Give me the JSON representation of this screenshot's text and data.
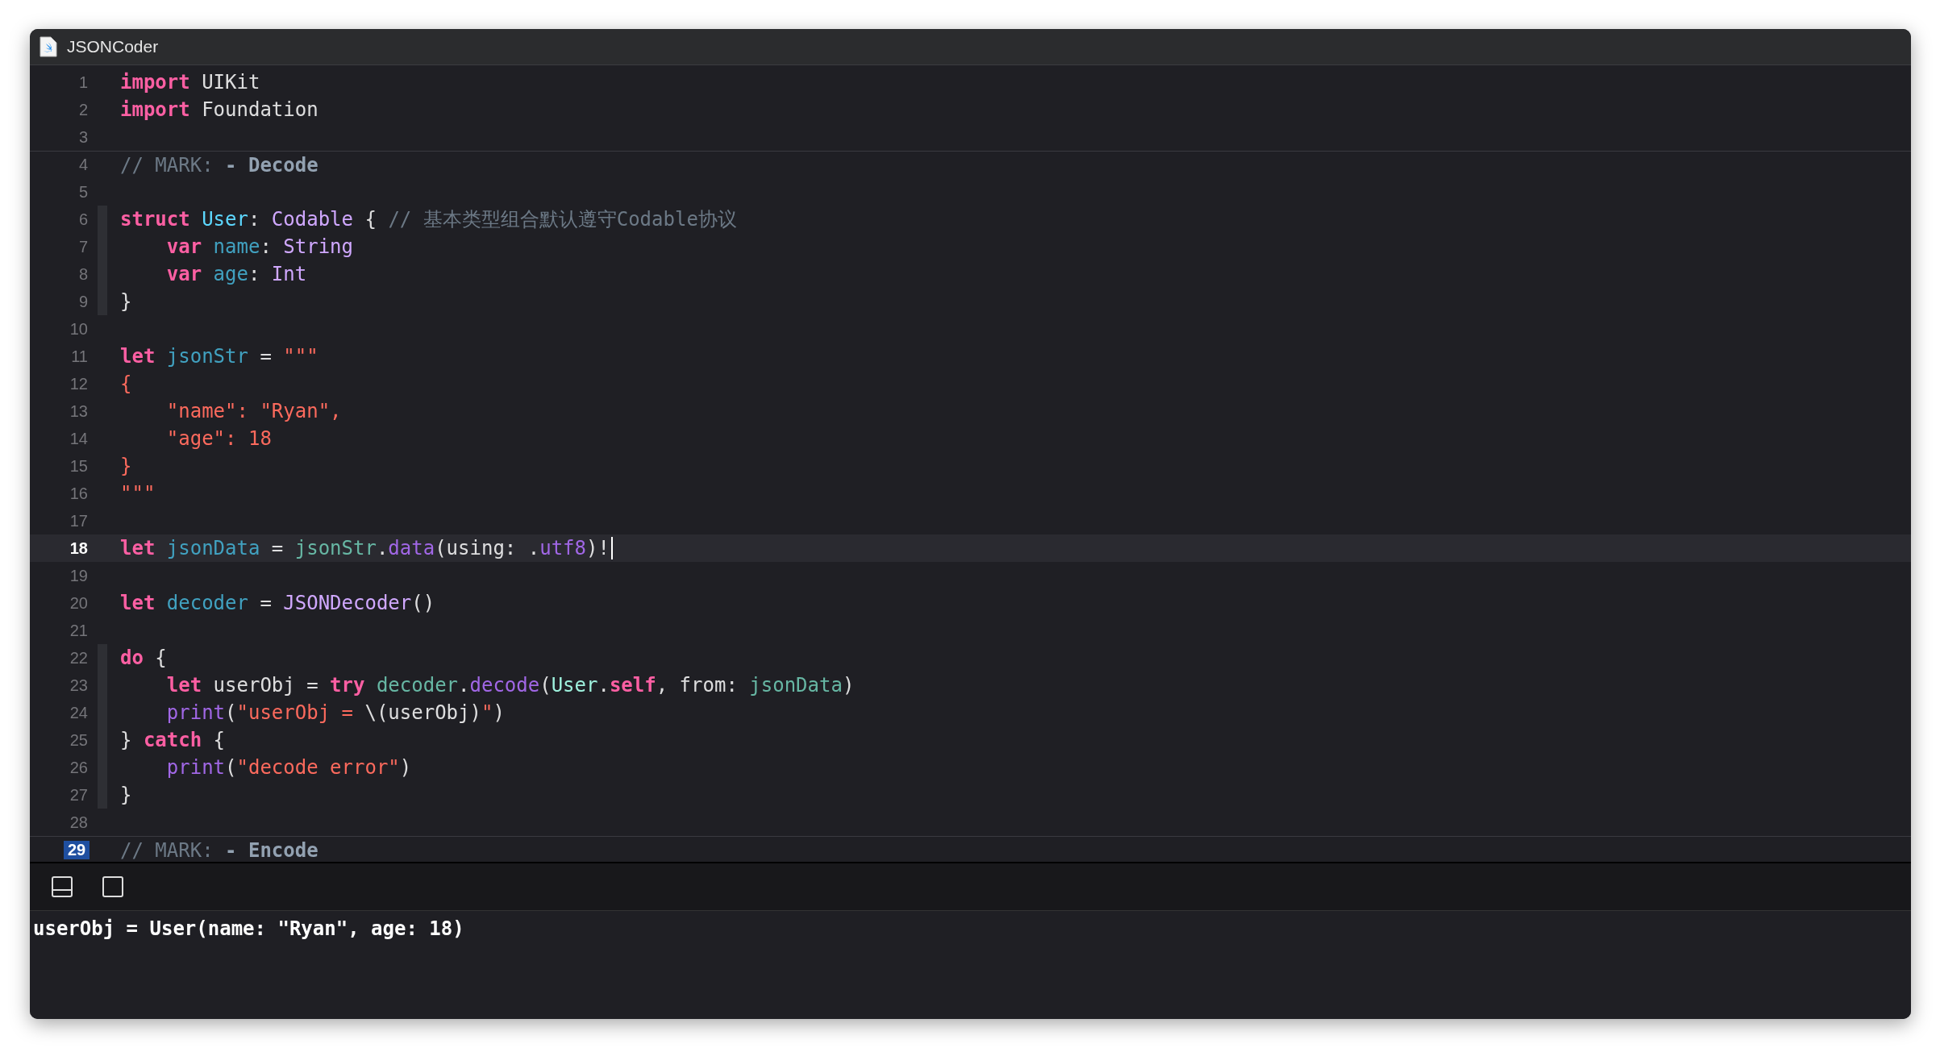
{
  "window": {
    "title": "JSONCoder"
  },
  "editor": {
    "lines": [
      {
        "number": "1",
        "current": false,
        "number_highlighted": false,
        "fold": false,
        "tokens": [
          {
            "text": "import",
            "kind": "keyword"
          },
          {
            "text": " UIKit",
            "kind": "plain"
          }
        ]
      },
      {
        "number": "2",
        "current": false,
        "number_highlighted": false,
        "fold": false,
        "tokens": [
          {
            "text": "import",
            "kind": "keyword"
          },
          {
            "text": " Foundation",
            "kind": "plain"
          }
        ]
      },
      {
        "number": "3",
        "current": false,
        "number_highlighted": false,
        "fold": false
      },
      {
        "number": "4",
        "current": false,
        "number_highlighted": false,
        "fold": false,
        "tokens": [
          {
            "text": "// MARK: ",
            "kind": "comment"
          },
          {
            "text": "- Decode",
            "kind": "mark"
          }
        ]
      },
      {
        "number": "5",
        "current": false,
        "number_highlighted": false,
        "fold": false
      },
      {
        "number": "6",
        "current": false,
        "number_highlighted": false,
        "fold": true,
        "tokens": [
          {
            "text": "struct ",
            "kind": "keyword"
          },
          {
            "text": "User",
            "kind": "type_decl"
          },
          {
            "text": ": ",
            "kind": "plain"
          },
          {
            "text": "Codable",
            "kind": "type"
          },
          {
            "text": " { ",
            "kind": "plain"
          },
          {
            "text": "// 基本类型组合默认遵守Codable协议",
            "kind": "comment"
          }
        ]
      },
      {
        "number": "7",
        "current": false,
        "number_highlighted": false,
        "fold": true,
        "tokens": [
          {
            "text": "    var ",
            "kind": "keyword"
          },
          {
            "text": "name",
            "kind": "decl"
          },
          {
            "text": ": ",
            "kind": "plain"
          },
          {
            "text": "String",
            "kind": "type"
          }
        ]
      },
      {
        "number": "8",
        "current": false,
        "number_highlighted": false,
        "fold": true,
        "tokens": [
          {
            "text": "    var ",
            "kind": "keyword"
          },
          {
            "text": "age",
            "kind": "decl"
          },
          {
            "text": ": ",
            "kind": "plain"
          },
          {
            "text": "Int",
            "kind": "type"
          }
        ]
      },
      {
        "number": "9",
        "current": false,
        "number_highlighted": false,
        "fold": true,
        "tokens": [
          {
            "text": "}",
            "kind": "plain"
          }
        ]
      },
      {
        "number": "10",
        "current": false,
        "number_highlighted": false,
        "fold": false
      },
      {
        "number": "11",
        "current": false,
        "number_highlighted": false,
        "fold": false,
        "tokens": [
          {
            "text": "let ",
            "kind": "keyword"
          },
          {
            "text": "jsonStr",
            "kind": "decl"
          },
          {
            "text": " = ",
            "kind": "plain"
          },
          {
            "text": "\"\"\"",
            "kind": "string"
          }
        ]
      },
      {
        "number": "12",
        "current": false,
        "number_highlighted": false,
        "fold": false,
        "tokens": [
          {
            "text": "{",
            "kind": "string"
          }
        ]
      },
      {
        "number": "13",
        "current": false,
        "number_highlighted": false,
        "fold": false,
        "tokens": [
          {
            "text": "    \"name\": \"Ryan\",",
            "kind": "string"
          }
        ]
      },
      {
        "number": "14",
        "current": false,
        "number_highlighted": false,
        "fold": false,
        "tokens": [
          {
            "text": "    \"age\": 18",
            "kind": "string"
          }
        ]
      },
      {
        "number": "15",
        "current": false,
        "number_highlighted": false,
        "fold": false,
        "tokens": [
          {
            "text": "}",
            "kind": "string"
          }
        ]
      },
      {
        "number": "16",
        "current": false,
        "number_highlighted": false,
        "fold": false,
        "tokens": [
          {
            "text": "\"\"\"",
            "kind": "string"
          }
        ]
      },
      {
        "number": "17",
        "current": false,
        "number_highlighted": false,
        "fold": false
      },
      {
        "number": "18",
        "current": true,
        "number_highlighted": false,
        "fold": false,
        "tokens": [
          {
            "text": "let ",
            "kind": "keyword"
          },
          {
            "text": "jsonData",
            "kind": "decl"
          },
          {
            "text": " = ",
            "kind": "plain"
          },
          {
            "text": "jsonStr",
            "kind": "ref"
          },
          {
            "text": ".",
            "kind": "plain"
          },
          {
            "text": "data",
            "kind": "func"
          },
          {
            "text": "(using: .",
            "kind": "plain"
          },
          {
            "text": "utf8",
            "kind": "func"
          },
          {
            "text": ")!",
            "kind": "plain"
          }
        ]
      },
      {
        "number": "19",
        "current": false,
        "number_highlighted": false,
        "fold": false
      },
      {
        "number": "20",
        "current": false,
        "number_highlighted": false,
        "fold": false,
        "tokens": [
          {
            "text": "let ",
            "kind": "keyword"
          },
          {
            "text": "decoder",
            "kind": "decl"
          },
          {
            "text": " = ",
            "kind": "plain"
          },
          {
            "text": "JSONDecoder",
            "kind": "type"
          },
          {
            "text": "()",
            "kind": "plain"
          }
        ]
      },
      {
        "number": "21",
        "current": false,
        "number_highlighted": false,
        "fold": false
      },
      {
        "number": "22",
        "current": false,
        "number_highlighted": false,
        "fold": true,
        "tokens": [
          {
            "text": "do",
            "kind": "keyword"
          },
          {
            "text": " {",
            "kind": "plain"
          }
        ]
      },
      {
        "number": "23",
        "current": false,
        "number_highlighted": false,
        "fold": true,
        "tokens": [
          {
            "text": "    let",
            "kind": "keyword"
          },
          {
            "text": " userObj = ",
            "kind": "plain"
          },
          {
            "text": "try ",
            "kind": "keyword"
          },
          {
            "text": "decoder",
            "kind": "ref"
          },
          {
            "text": ".",
            "kind": "plain"
          },
          {
            "text": "decode",
            "kind": "func"
          },
          {
            "text": "(",
            "kind": "plain"
          },
          {
            "text": "User",
            "kind": "type_ref"
          },
          {
            "text": ".",
            "kind": "plain"
          },
          {
            "text": "self",
            "kind": "keyword"
          },
          {
            "text": ", from: ",
            "kind": "plain"
          },
          {
            "text": "jsonData",
            "kind": "ref"
          },
          {
            "text": ")",
            "kind": "plain"
          }
        ]
      },
      {
        "number": "24",
        "current": false,
        "number_highlighted": false,
        "fold": true,
        "tokens": [
          {
            "text": "    print",
            "kind": "func"
          },
          {
            "text": "(",
            "kind": "plain"
          },
          {
            "text": "\"userObj = ",
            "kind": "string"
          },
          {
            "text": "\\(userObj)",
            "kind": "plain"
          },
          {
            "text": "\"",
            "kind": "string"
          },
          {
            "text": ")",
            "kind": "plain"
          }
        ]
      },
      {
        "number": "25",
        "current": false,
        "number_highlighted": false,
        "fold": true,
        "tokens": [
          {
            "text": "} ",
            "kind": "plain"
          },
          {
            "text": "catch",
            "kind": "keyword"
          },
          {
            "text": " {",
            "kind": "plain"
          }
        ]
      },
      {
        "number": "26",
        "current": false,
        "number_highlighted": false,
        "fold": true,
        "tokens": [
          {
            "text": "    print",
            "kind": "func"
          },
          {
            "text": "(",
            "kind": "plain"
          },
          {
            "text": "\"decode error\"",
            "kind": "string"
          },
          {
            "text": ")",
            "kind": "plain"
          }
        ]
      },
      {
        "number": "27",
        "current": false,
        "number_highlighted": false,
        "fold": true,
        "tokens": [
          {
            "text": "}",
            "kind": "plain"
          }
        ]
      },
      {
        "number": "28",
        "current": false,
        "number_highlighted": false,
        "fold": false
      },
      {
        "number": "29",
        "current": false,
        "number_highlighted": true,
        "fold": false,
        "tokens": [
          {
            "text": "// MARK: ",
            "kind": "comment"
          },
          {
            "text": "- Encode",
            "kind": "mark"
          }
        ]
      }
    ]
  },
  "console": {
    "output": "userObj = User(name: \"Ryan\", age: 18)"
  }
}
